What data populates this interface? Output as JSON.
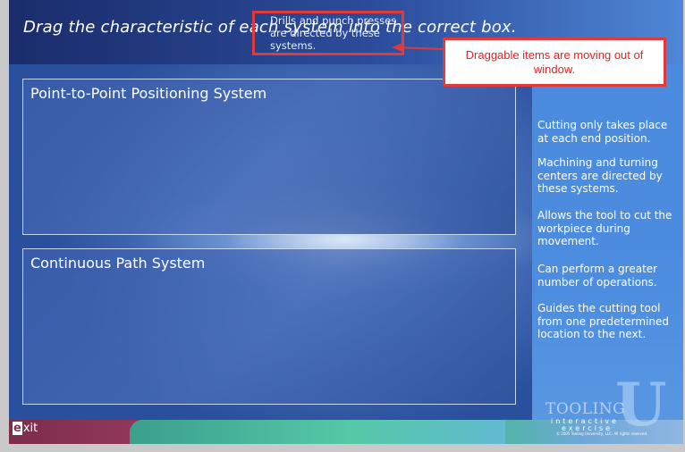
{
  "instruction": "Drag the characteristic of each system into the correct box.",
  "drop_boxes": [
    {
      "label": "Point-to-Point Positioning System"
    },
    {
      "label": "Continuous Path System"
    }
  ],
  "moving_item": "Drills and punch presses are directed by these systems.",
  "items": [
    "Cutting only takes place at each end position.",
    "Machining and turning centers are directed by these systems.",
    "Allows the tool to cut the workpiece during movement.",
    "Can perform a greater number of operations.",
    "Guides the cutting tool from one predetermined location to the next."
  ],
  "callout": "Draggable items are moving out of window.",
  "footer": {
    "exit_prefix": "e",
    "exit_rest": "xit",
    "logo_brand": "TOOLING",
    "logo_letter": "U",
    "logo_sub1": "interactive",
    "logo_sub2": "exercise",
    "logo_copyright": "© 2005 Tooling University, LLC. All rights reserved."
  },
  "colors": {
    "annotation_red": "#e03a3a",
    "background_blue": "#4d77c0"
  }
}
